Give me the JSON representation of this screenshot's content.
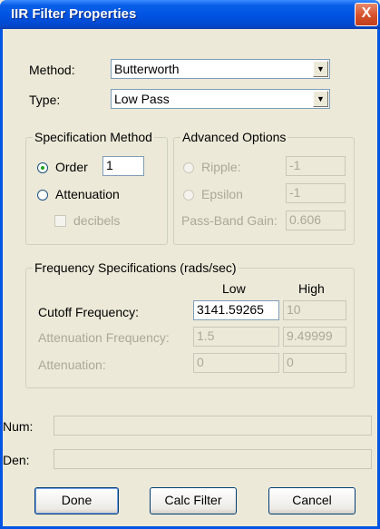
{
  "window": {
    "title": "IIR Filter Properties",
    "close_glyph": "X"
  },
  "method": {
    "label": "Method:",
    "value": "Butterworth"
  },
  "type": {
    "label": "Type:",
    "value": "Low Pass"
  },
  "spec_method": {
    "legend": "Specification Method",
    "order_label": "Order",
    "order_value": "1",
    "attenuation_label": "Attenuation",
    "decibels_label": "decibels"
  },
  "advanced": {
    "legend": "Advanced Options",
    "ripple_label": "Ripple:",
    "ripple_value": "-1",
    "epsilon_label": "Epsilon",
    "epsilon_value": "-1",
    "gain_label": "Pass-Band Gain:",
    "gain_value": "0.606"
  },
  "freq": {
    "legend": "Frequency Specifications (rads/sec)",
    "low_header": "Low",
    "high_header": "High",
    "cutoff_label": "Cutoff Frequency:",
    "cutoff_low": "3141.59265",
    "cutoff_high": "10",
    "atten_freq_label": "Attenuation Frequency:",
    "atten_freq_low": "1.5",
    "atten_freq_high": "9.49999",
    "atten_label": "Attenuation:",
    "atten_low": "0",
    "atten_high": "0"
  },
  "num": {
    "label": "Num:",
    "value": ""
  },
  "den": {
    "label": "Den:",
    "value": ""
  },
  "buttons": {
    "done": "Done",
    "calc": "Calc Filter",
    "cancel": "Cancel"
  },
  "icons": {
    "combo_arrow": "dropdown-arrow-icon",
    "close": "close-icon"
  }
}
